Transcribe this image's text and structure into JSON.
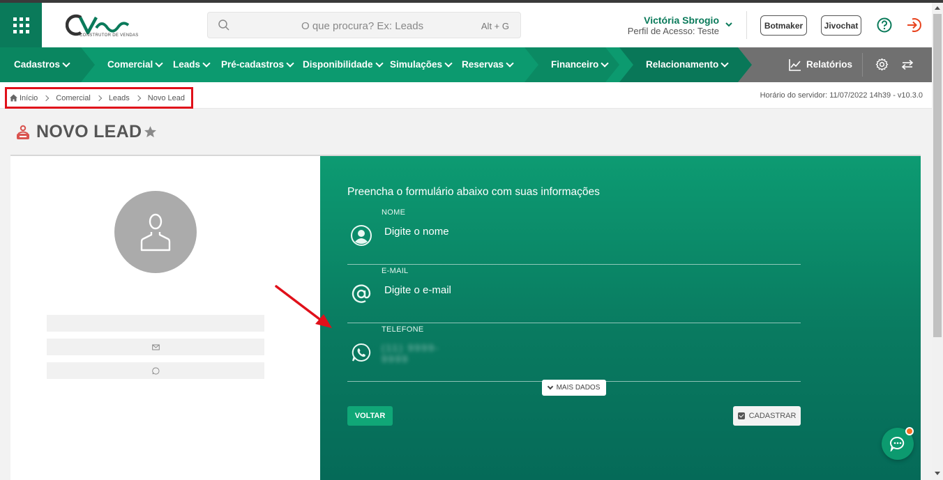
{
  "header": {
    "logo_text": "CV",
    "logo_subtitle": "CONSTRUTOR DE VENDAS",
    "search_placeholder": "O que procura? Ex: Leads",
    "search_shortcut": "Alt + G",
    "user_name": "Victória Sbrogio",
    "user_role": "Perfil de Acesso: Teste",
    "botmaker_label": "Botmaker",
    "jivochat_label": "Jivochat"
  },
  "nav": {
    "items": [
      {
        "label": "Cadastros"
      },
      {
        "label": "Comercial"
      },
      {
        "label": "Leads"
      },
      {
        "label": "Pré-cadastros"
      },
      {
        "label": "Disponibilidade"
      },
      {
        "label": "Simulações"
      },
      {
        "label": "Reservas"
      },
      {
        "label": "Financeiro"
      },
      {
        "label": "Relacionamento"
      }
    ],
    "reports_label": "Relatórios",
    "colors": {
      "primary": "#0c9a6f",
      "dark": "#0a7a5a",
      "right": "#707070"
    }
  },
  "breadcrumb": {
    "items": [
      "Início",
      "Comercial",
      "Leads",
      "Novo Lead"
    ],
    "server_time": "Horário do servidor: 11/07/2022 14h39 - v10.3.0"
  },
  "page": {
    "title": "NOVO LEAD"
  },
  "form": {
    "heading": "Preencha o formulário abaixo com suas informações",
    "fields": [
      {
        "label": "NOME",
        "value": "Digite o nome",
        "icon": "user-circle-icon"
      },
      {
        "label": "E-MAIL",
        "value": "Digite o e-mail",
        "icon": "at-sign-icon"
      },
      {
        "label": "TELEFONE",
        "value": "(11) 9999-9999",
        "icon": "whatsapp-icon"
      }
    ],
    "more_label": "MAIS DADOS",
    "back_label": "VOLTAR",
    "submit_label": "CADASTRAR"
  }
}
